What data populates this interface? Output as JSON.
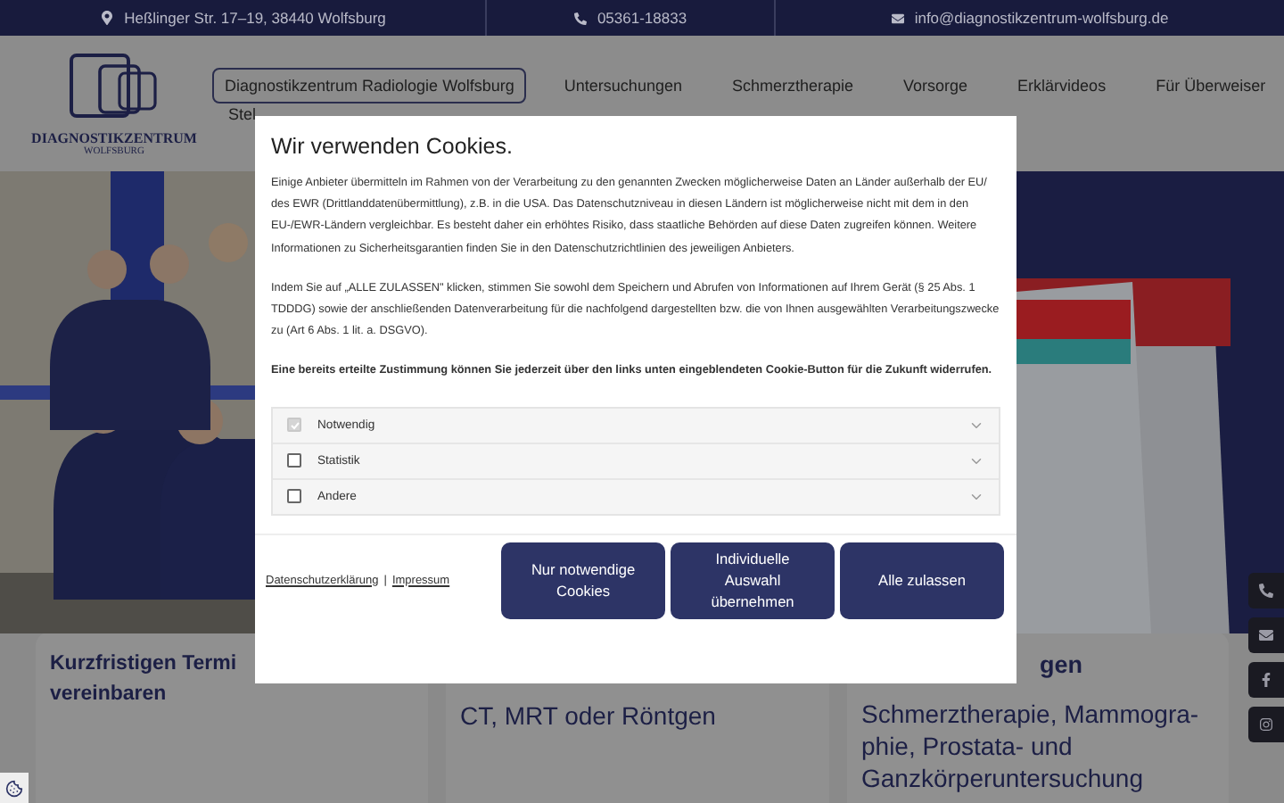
{
  "top_bar": {
    "address": "Heßlinger Str. 17–19, 38440 Wolfsburg",
    "phone": "05361-18833",
    "email": "info@diagnostikzentrum-wolfsburg.de"
  },
  "logo": {
    "name": "DIAGNOSTIKZENTRUM",
    "city": "WOLFSBURG"
  },
  "nav": {
    "items": [
      {
        "label": "Diagnostikzentrum Radiologie Wolfsburg",
        "selected": true
      },
      {
        "label": "Untersuchungen",
        "selected": false
      },
      {
        "label": "Schmerztherapie",
        "selected": false
      },
      {
        "label": "Vorsorge",
        "selected": false
      },
      {
        "label": "Erklärvideos",
        "selected": false
      },
      {
        "label": "Für Überweiser",
        "selected": false
      }
    ],
    "second_row": "Stel"
  },
  "side_buttons": [
    {
      "kind": "phone"
    },
    {
      "kind": "mail"
    },
    {
      "kind": "facebook"
    },
    {
      "kind": "instagram"
    }
  ],
  "cards": [
    {
      "title": "Kurzfristigen Termi\nvereinbaren"
    },
    {
      "body": "CT, MRT oder Röntgen"
    },
    {
      "title": "gen",
      "body": "Schmerztherapie, Mammogra-phie, Prostata- und Ganzkörperuntersuchung"
    }
  ],
  "cookie_dialog": {
    "title": "Wir verwenden Cookies.",
    "paragraphs": [
      {
        "text": "Einige Anbieter übermitteln im Rahmen von der Verarbeitung zu den genannten Zwecken möglicherweise Daten an Länder außerhalb der EU/ des EWR (Drittlanddatenübermittlung), z.B. in die USA. Das Datenschutzniveau in diesen Ländern ist möglicherweise nicht mit dem in den EU-/EWR-Ländern vergleichbar. Es besteht daher ein erhöhtes Risiko, dass staatliche Behörden auf diese Daten zugreifen können. Weitere Informationen zu Sicherheitsgarantien finden Sie in den Datenschutzrichtlinien des jeweiligen Anbieters.",
        "bold": false
      },
      {
        "text": "Indem Sie auf „ALLE ZULASSEN\" klicken, stimmen Sie sowohl dem Speichern und Abrufen von Informationen auf Ihrem Gerät (§ 25 Abs. 1 TDDDG) sowie der anschließenden Datenverarbeitung für die nachfolgend dargestellten bzw. die von Ihnen ausgewählten Verarbeitungszwecke zu (Art 6 Abs. 1 lit. a. DSGVO).",
        "bold": false
      },
      {
        "text": "Eine bereits erteilte Zustimmung können Sie jederzeit über den links unten eingeblendeten Cookie-Button für die Zukunft widerrufen.",
        "bold": true
      }
    ],
    "categories": [
      {
        "label": "Notwendig",
        "checked": true,
        "disabled": true
      },
      {
        "label": "Statistik",
        "checked": false,
        "disabled": false
      },
      {
        "label": "Andere",
        "checked": false,
        "disabled": false
      }
    ],
    "links": [
      "Datenschutzerklärung",
      "Impressum"
    ],
    "separator": "|",
    "buttons": [
      "Nur notwendige Cookies",
      "Individuelle Auswahl übernehmen",
      "Alle zulassen"
    ]
  }
}
